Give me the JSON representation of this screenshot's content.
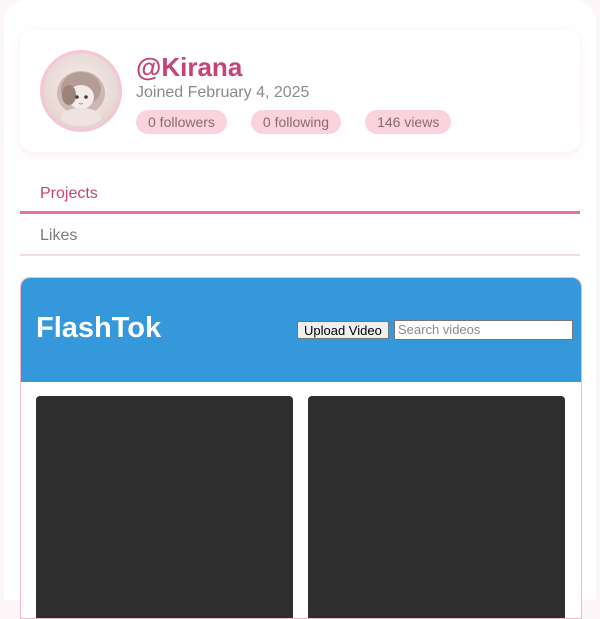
{
  "profile": {
    "username": "@Kirana",
    "joined": "Joined February 4, 2025",
    "stats": {
      "followers": "0 followers",
      "following": "0 following",
      "views": "146 views"
    }
  },
  "tabs": {
    "projects": "Projects",
    "likes": "Likes"
  },
  "embed": {
    "app_title": "FlashTok",
    "upload_label": "Upload Video",
    "search_placeholder": "Search videos"
  },
  "colors": {
    "accent": "#c2447a",
    "tab_underline": "#e96fa8",
    "stat_pill": "#fbd3de",
    "app_header": "#3498db",
    "video_tile": "#2e2e2e"
  }
}
